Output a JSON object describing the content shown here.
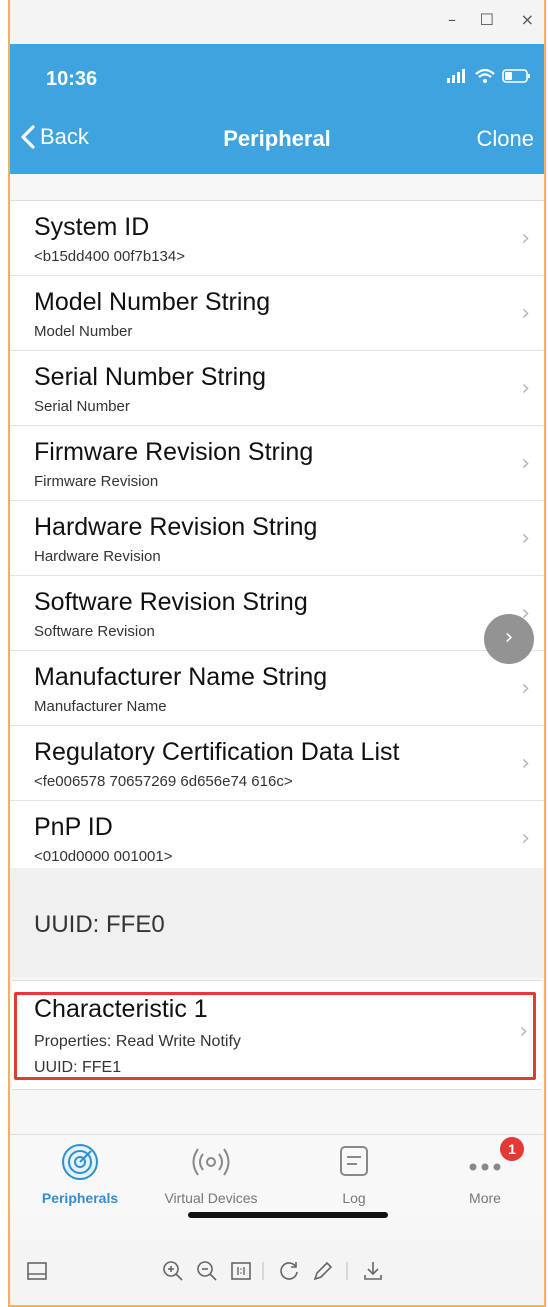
{
  "window": {
    "minimize": "–",
    "maximize": "☐",
    "close": "×"
  },
  "status_bar": {
    "time": "10:36"
  },
  "nav": {
    "back_label": "Back",
    "title": "Peripheral",
    "action_label": "Clone"
  },
  "services": [
    {
      "title": "System ID",
      "subtitle": "<b15dd400 00f7b134>"
    },
    {
      "title": "Model Number String",
      "subtitle": "Model Number"
    },
    {
      "title": "Serial Number String",
      "subtitle": "Serial Number"
    },
    {
      "title": "Firmware Revision String",
      "subtitle": "Firmware Revision"
    },
    {
      "title": "Hardware Revision String",
      "subtitle": "Hardware Revision"
    },
    {
      "title": "Software Revision String",
      "subtitle": "Software Revision"
    },
    {
      "title": "Manufacturer Name String",
      "subtitle": "Manufacturer Name"
    },
    {
      "title": "Regulatory Certification Data List",
      "subtitle": "<fe006578 70657269 6d656e74 616c>"
    },
    {
      "title": "PnP ID",
      "subtitle": "<010d0000 001001>"
    }
  ],
  "uuid_section": {
    "header": "UUID: FFE0"
  },
  "characteristic": {
    "title": "Characteristic 1",
    "properties": "Properties: Read Write Notify",
    "uuid": "UUID: FFE1"
  },
  "tab_bar": {
    "tabs": [
      {
        "label": "Peripherals",
        "icon": "peripherals-icon",
        "active": true
      },
      {
        "label": "Virtual Devices",
        "icon": "broadcast-icon",
        "active": false
      },
      {
        "label": "Log",
        "icon": "log-icon",
        "active": false
      },
      {
        "label": "More",
        "icon": "more-icon",
        "active": false
      }
    ],
    "more_badge": "1"
  },
  "colors": {
    "accent": "#3ea3df",
    "highlight": "#e53935",
    "badge": "#e53935"
  }
}
